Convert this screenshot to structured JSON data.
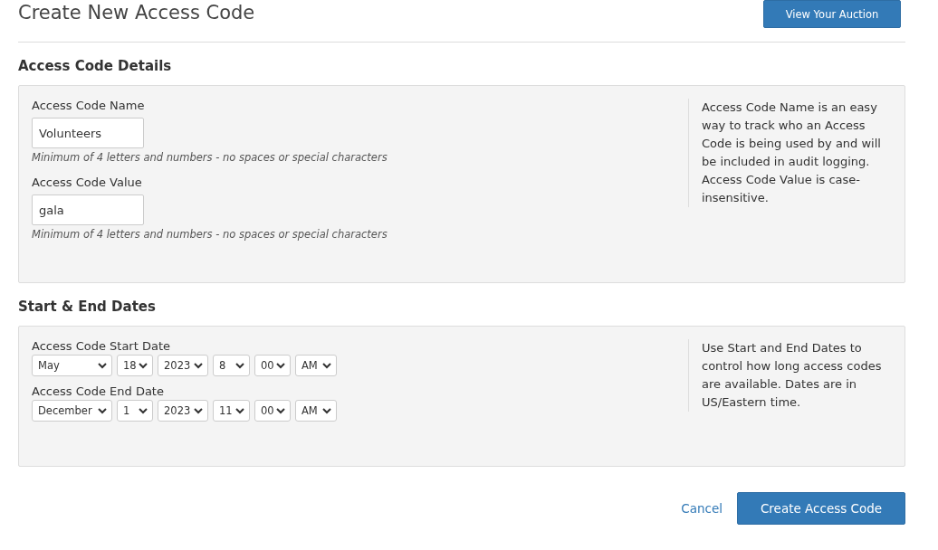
{
  "page": {
    "title": "Create New Access Code",
    "header_button": "View Your Auction"
  },
  "details": {
    "heading": "Access Code Details",
    "fields": [
      {
        "label": "Access Code Name",
        "value": "Volunteers",
        "hint": "Minimum of 4 letters and numbers - no spaces or special characters"
      },
      {
        "label": "Access Code Value",
        "value": "gala",
        "hint": "Minimum of 4 letters and numbers - no spaces or special characters"
      }
    ],
    "help": "Access Code Name is an easy way to track who an Access Code is being used by and will be included in audit logging. Access Code Value is case-insensitive."
  },
  "dates": {
    "heading": "Start & End Dates",
    "rows": [
      {
        "label": "Access Code Start Date",
        "month": "May",
        "day": "18",
        "year": "2023",
        "hour": "8",
        "minute": "00",
        "ampm": "AM"
      },
      {
        "label": "Access Code End Date",
        "month": "December",
        "day": "1",
        "year": "2023",
        "hour": "11",
        "minute": "00",
        "ampm": "AM"
      }
    ],
    "help": "Use Start and End Dates to control how long access codes are available. Dates are in US/Eastern time."
  },
  "actions": {
    "cancel": "Cancel",
    "submit": "Create Access Code"
  }
}
